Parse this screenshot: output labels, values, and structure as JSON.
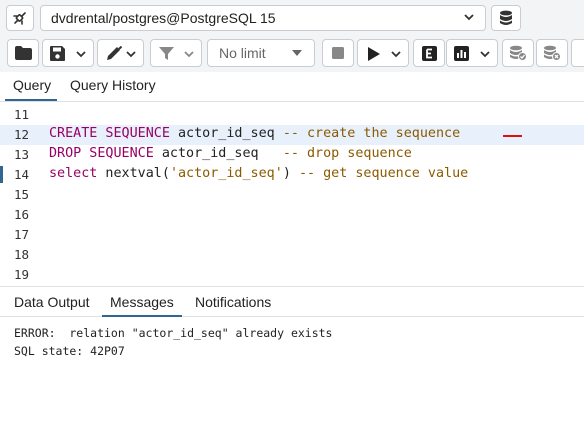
{
  "connection": {
    "label": "dvdrental/postgres@PostgreSQL 15",
    "connect_icon": "unplugged-icon",
    "db_icon": "database-stack-icon"
  },
  "toolbar": {
    "limit_label": "No limit",
    "items": [
      "folder-icon",
      "save-icon",
      "pen-icon",
      "filter-icon",
      "stop-icon",
      "play-icon",
      "explain-icon",
      "chart-icon",
      "commit-icon",
      "rollback-icon"
    ]
  },
  "tabs": {
    "query": "Query",
    "history": "Query History"
  },
  "editor": {
    "lines": [
      {
        "num": "11"
      },
      {
        "num": "12",
        "kw": "CREATE SEQUENCE",
        "id": " actor_id_seq ",
        "cm": "-- create the sequence"
      },
      {
        "num": "13",
        "kw": "DROP SEQUENCE",
        "id": " actor_id_seq   ",
        "cm": "-- drop sequence"
      },
      {
        "num": "14",
        "kw": "select",
        "id": " nextval(",
        "str": "'actor_id_seq'",
        "id2": ") ",
        "cm": "-- get sequence value"
      },
      {
        "num": "15"
      },
      {
        "num": "16"
      },
      {
        "num": "17"
      },
      {
        "num": "18"
      },
      {
        "num": "19"
      }
    ]
  },
  "output": {
    "tabs": [
      "Data Output",
      "Messages",
      "Notifications"
    ],
    "messages": [
      "ERROR:  relation \"actor_id_seq\" already exists",
      "SQL state: 42P07"
    ]
  },
  "colors": {
    "accent": "#326690",
    "keyword": "#990066",
    "comment": "#8a5a00",
    "active_line": "#e8f1fb"
  }
}
